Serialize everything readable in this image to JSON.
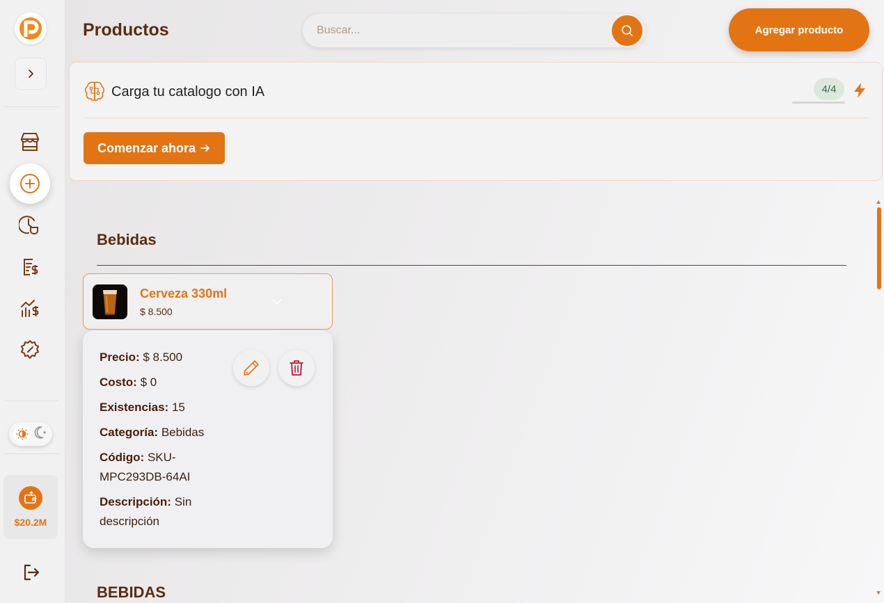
{
  "colors": {
    "accent": "#e37414",
    "text_dark": "#5a2d10",
    "danger": "#c8102e"
  },
  "header": {
    "title": "Productos",
    "search_placeholder": "Buscar...",
    "add_button": "Agregar producto"
  },
  "sidebar": {
    "logo_icon": "brand-logo",
    "expand_icon": "chevron-right-icon",
    "items": [
      {
        "icon": "store-icon"
      },
      {
        "icon": "plus-circle-icon",
        "active": true
      },
      {
        "icon": "clock-cup-icon"
      },
      {
        "icon": "invoice-dollar-icon"
      },
      {
        "icon": "chart-dollar-icon"
      },
      {
        "icon": "settings-gear-icon"
      }
    ],
    "theme_toggle": {
      "light_icon": "sun-icon",
      "dark_icon": "moon-icon"
    },
    "balance": {
      "icon": "wallet-icon",
      "amount": "$20.2M"
    },
    "logout_icon": "logout-icon"
  },
  "ai_banner": {
    "title": "Carga tu catalogo con IA",
    "counter": "4/4",
    "button": "Comenzar ahora"
  },
  "categories": [
    {
      "name": "Bebidas",
      "products": [
        {
          "name": "Cerveza 330ml",
          "price": "$ 8.500",
          "details": {
            "precio_label": "Precio:",
            "precio": "$ 8.500",
            "costo_label": "Costo:",
            "costo": "$ 0",
            "existencias_label": "Existencias:",
            "existencias": "15",
            "categoria_label": "Categoría:",
            "categoria": "Bebidas",
            "codigo_label": "Código:",
            "codigo": "SKU-MPC293DB-64AI",
            "descripcion_label": "Descripción:",
            "descripcion": "Sin descripción"
          }
        }
      ]
    },
    {
      "name": "BEBIDAS",
      "products": []
    }
  ]
}
